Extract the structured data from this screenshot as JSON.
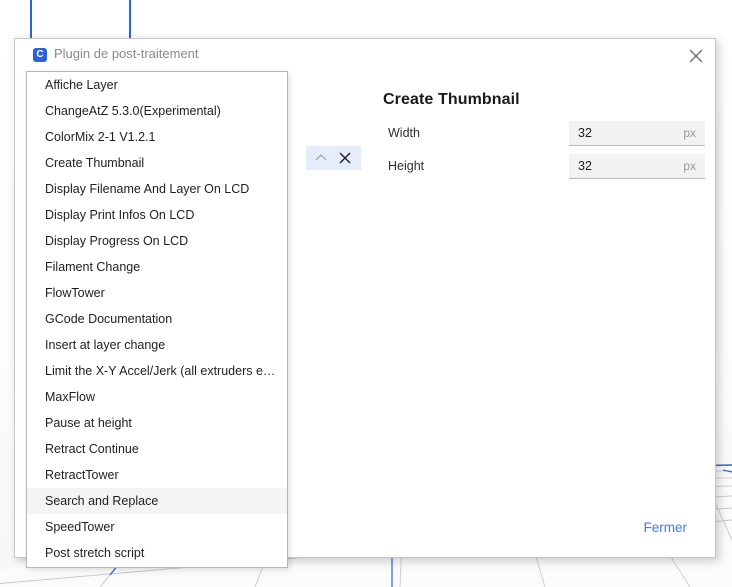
{
  "window": {
    "title": "Plugin de post-traitement",
    "app_icon": "cura-logo-icon",
    "app_icon_letter": "C",
    "close_icon": "close-icon"
  },
  "colors": {
    "accent_blue": "#3d7af5",
    "logo_blue": "#2a62d8",
    "grid_blue": "#2f66d6",
    "selected_row_bg": "#e6edfa",
    "field_bg": "#f2f2f2",
    "hover_bg": "#f4f4f4"
  },
  "plugin_list": {
    "highlighted_index": 16,
    "items": [
      {
        "label": "Affiche Layer"
      },
      {
        "label": "ChangeAtZ 5.3.0(Experimental)"
      },
      {
        "label": "ColorMix 2-1 V1.2.1"
      },
      {
        "label": "Create Thumbnail"
      },
      {
        "label": "Display Filename And Layer On LCD"
      },
      {
        "label": "Display Print Infos On LCD"
      },
      {
        "label": "Display Progress On LCD"
      },
      {
        "label": "Filament Change"
      },
      {
        "label": "FlowTower"
      },
      {
        "label": "GCode Documentation"
      },
      {
        "label": "Insert at layer change"
      },
      {
        "label": "Limit the X-Y Accel/Jerk (all extruders equal)"
      },
      {
        "label": "MaxFlow"
      },
      {
        "label": "Pause at height"
      },
      {
        "label": "Retract Continue"
      },
      {
        "label": "RetractTower"
      },
      {
        "label": "Search and Replace"
      },
      {
        "label": "SpeedTower"
      },
      {
        "label": "Post stretch script"
      }
    ]
  },
  "script_row": {
    "collapse_icon": "chevron-up-icon",
    "remove_icon": "close-icon"
  },
  "settings": {
    "title": "Create Thumbnail",
    "rows": [
      {
        "label": "Width",
        "value": "32",
        "unit": "px"
      },
      {
        "label": "Height",
        "value": "32",
        "unit": "px"
      }
    ]
  },
  "footer": {
    "close_label": "Fermer"
  }
}
